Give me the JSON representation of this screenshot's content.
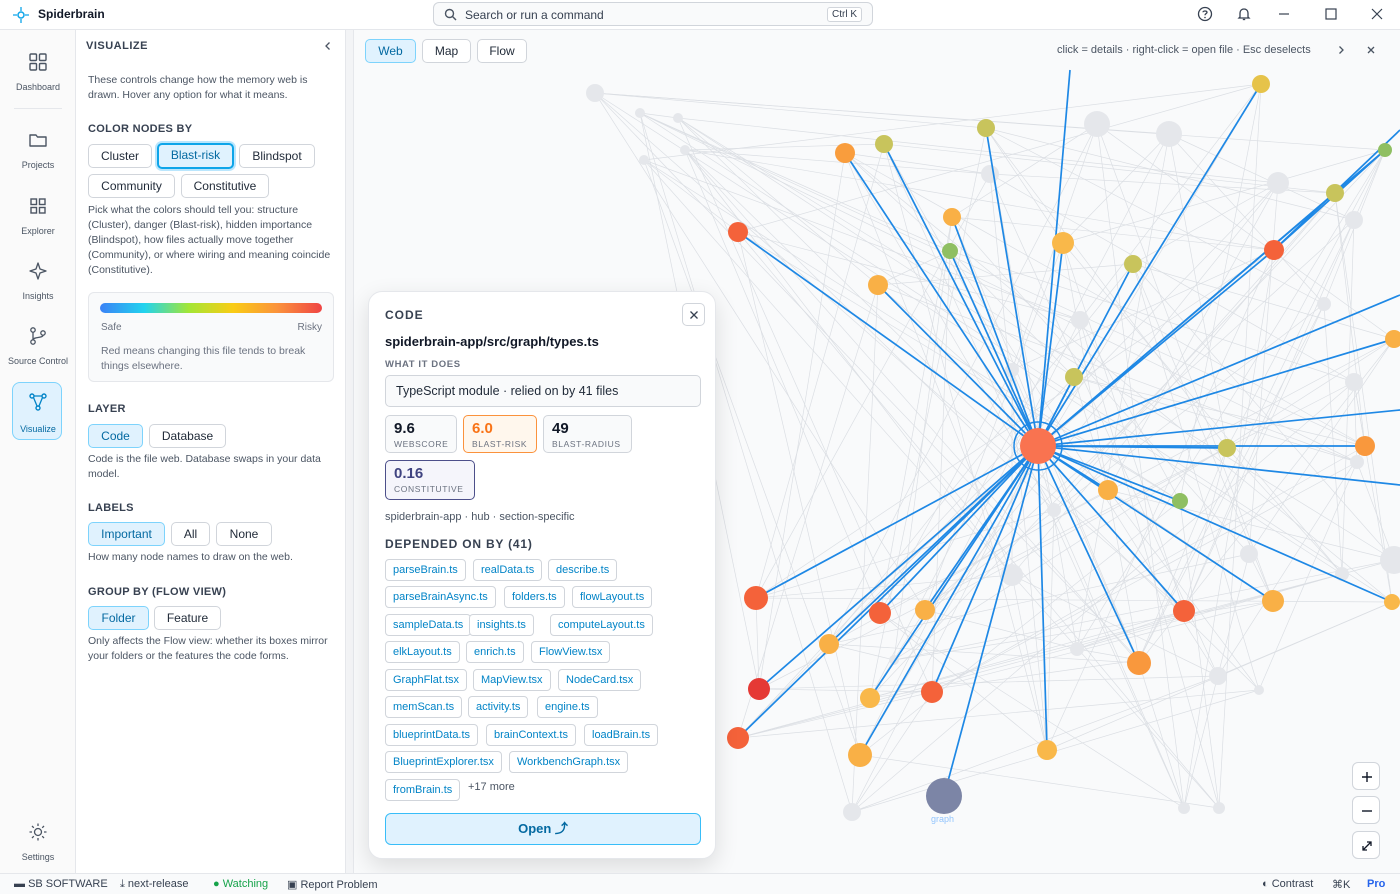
{
  "app": {
    "name": "Spiderbrain"
  },
  "search": {
    "placeholder": "Search or run a command",
    "shortcut": "Ctrl K"
  },
  "rail": {
    "items": [
      {
        "label": "Dashboard",
        "icon": "dashboard-icon"
      },
      {
        "label": "Projects",
        "icon": "folder-icon"
      },
      {
        "label": "Explorer",
        "icon": "grid-icon"
      },
      {
        "label": "Insights",
        "icon": "sparkle-icon"
      },
      {
        "label": "Source Control",
        "icon": "branch-icon"
      },
      {
        "label": "Visualize",
        "icon": "network-icon",
        "active": true
      }
    ],
    "settings": "Settings"
  },
  "panel": {
    "title": "VISUALIZE",
    "intro": "These controls change how the memory web is drawn. Hover any option for what it means.",
    "color_by": {
      "heading": "COLOR NODES BY",
      "options": [
        "Cluster",
        "Blast-risk",
        "Blindspot",
        "Community",
        "Constitutive"
      ],
      "selected": "Blast-risk",
      "help": "Pick what the colors should tell you: structure (Cluster), danger (Blast-risk), hidden importance (Blindspot), how files actually move together (Community), or where wiring and meaning coincide (Constitutive)."
    },
    "legend": {
      "safe": "Safe",
      "risky": "Risky",
      "desc": "Red means changing this file tends to break things elsewhere."
    },
    "layer": {
      "heading": "LAYER",
      "options": [
        "Code",
        "Database"
      ],
      "selected": "Code",
      "help": "Code is the file web. Database swaps in your data model."
    },
    "labels": {
      "heading": "LABELS",
      "options": [
        "Important",
        "All",
        "None"
      ],
      "selected": "Important",
      "help": "How many node names to draw on the web."
    },
    "group_by": {
      "heading": "GROUP BY (FLOW VIEW)",
      "options": [
        "Folder",
        "Feature"
      ],
      "selected": "Folder",
      "help": "Only affects the Flow view: whether its boxes mirror your folders or the features the code forms."
    }
  },
  "canvas": {
    "views": [
      "Web",
      "Map",
      "Flow"
    ],
    "selected_view": "Web",
    "hint": "click = details · right-click = open file · Esc deselects",
    "node_label": "graph"
  },
  "detail": {
    "kind": "CODE",
    "path": "spiderbrain-app/src/graph/types.ts",
    "what_label": "WHAT IT DOES",
    "what": "TypeScript module · relied on by 41 files",
    "metrics": [
      {
        "value": "9.6",
        "label": "WEBSCORE"
      },
      {
        "value": "6.0",
        "label": "BLAST-RISK"
      },
      {
        "value": "49",
        "label": "BLAST-RADIUS"
      },
      {
        "value": "0.16",
        "label": "CONSTITUTIVE"
      }
    ],
    "tags": "spiderbrain-app · hub · section-specific",
    "deps_heading": "DEPENDED ON BY (41)",
    "deps": [
      "parseBrain.ts",
      "realData.ts",
      "describe.ts",
      "parseBrainAsync.ts",
      "folders.ts",
      "flowLayout.ts",
      "sampleData.ts",
      "insights.ts",
      "computeLayout.ts",
      "elkLayout.ts",
      "enrich.ts",
      "FlowView.tsx",
      "GraphFlat.tsx",
      "MapView.tsx",
      "NodeCard.tsx",
      "memScan.ts",
      "activity.ts",
      "engine.ts",
      "blueprintData.ts",
      "brainContext.ts",
      "loadBrain.ts",
      "BlueprintExplorer.tsx",
      "WorkbenchGraph.tsx",
      "fromBrain.ts"
    ],
    "more": "+17 more",
    "open": "Open ⤴"
  },
  "status": {
    "org": "SB SOFTWARE",
    "branch": "next-release",
    "watching": "Watching",
    "report": "Report Problem",
    "contrast": "Contrast",
    "cmdk": "⌘K",
    "plan": "Pro"
  },
  "colors": {
    "accent": "#0ea5e9",
    "edge": "#1e88e5",
    "hub": "#f97350",
    "danger": "#ef4444"
  }
}
